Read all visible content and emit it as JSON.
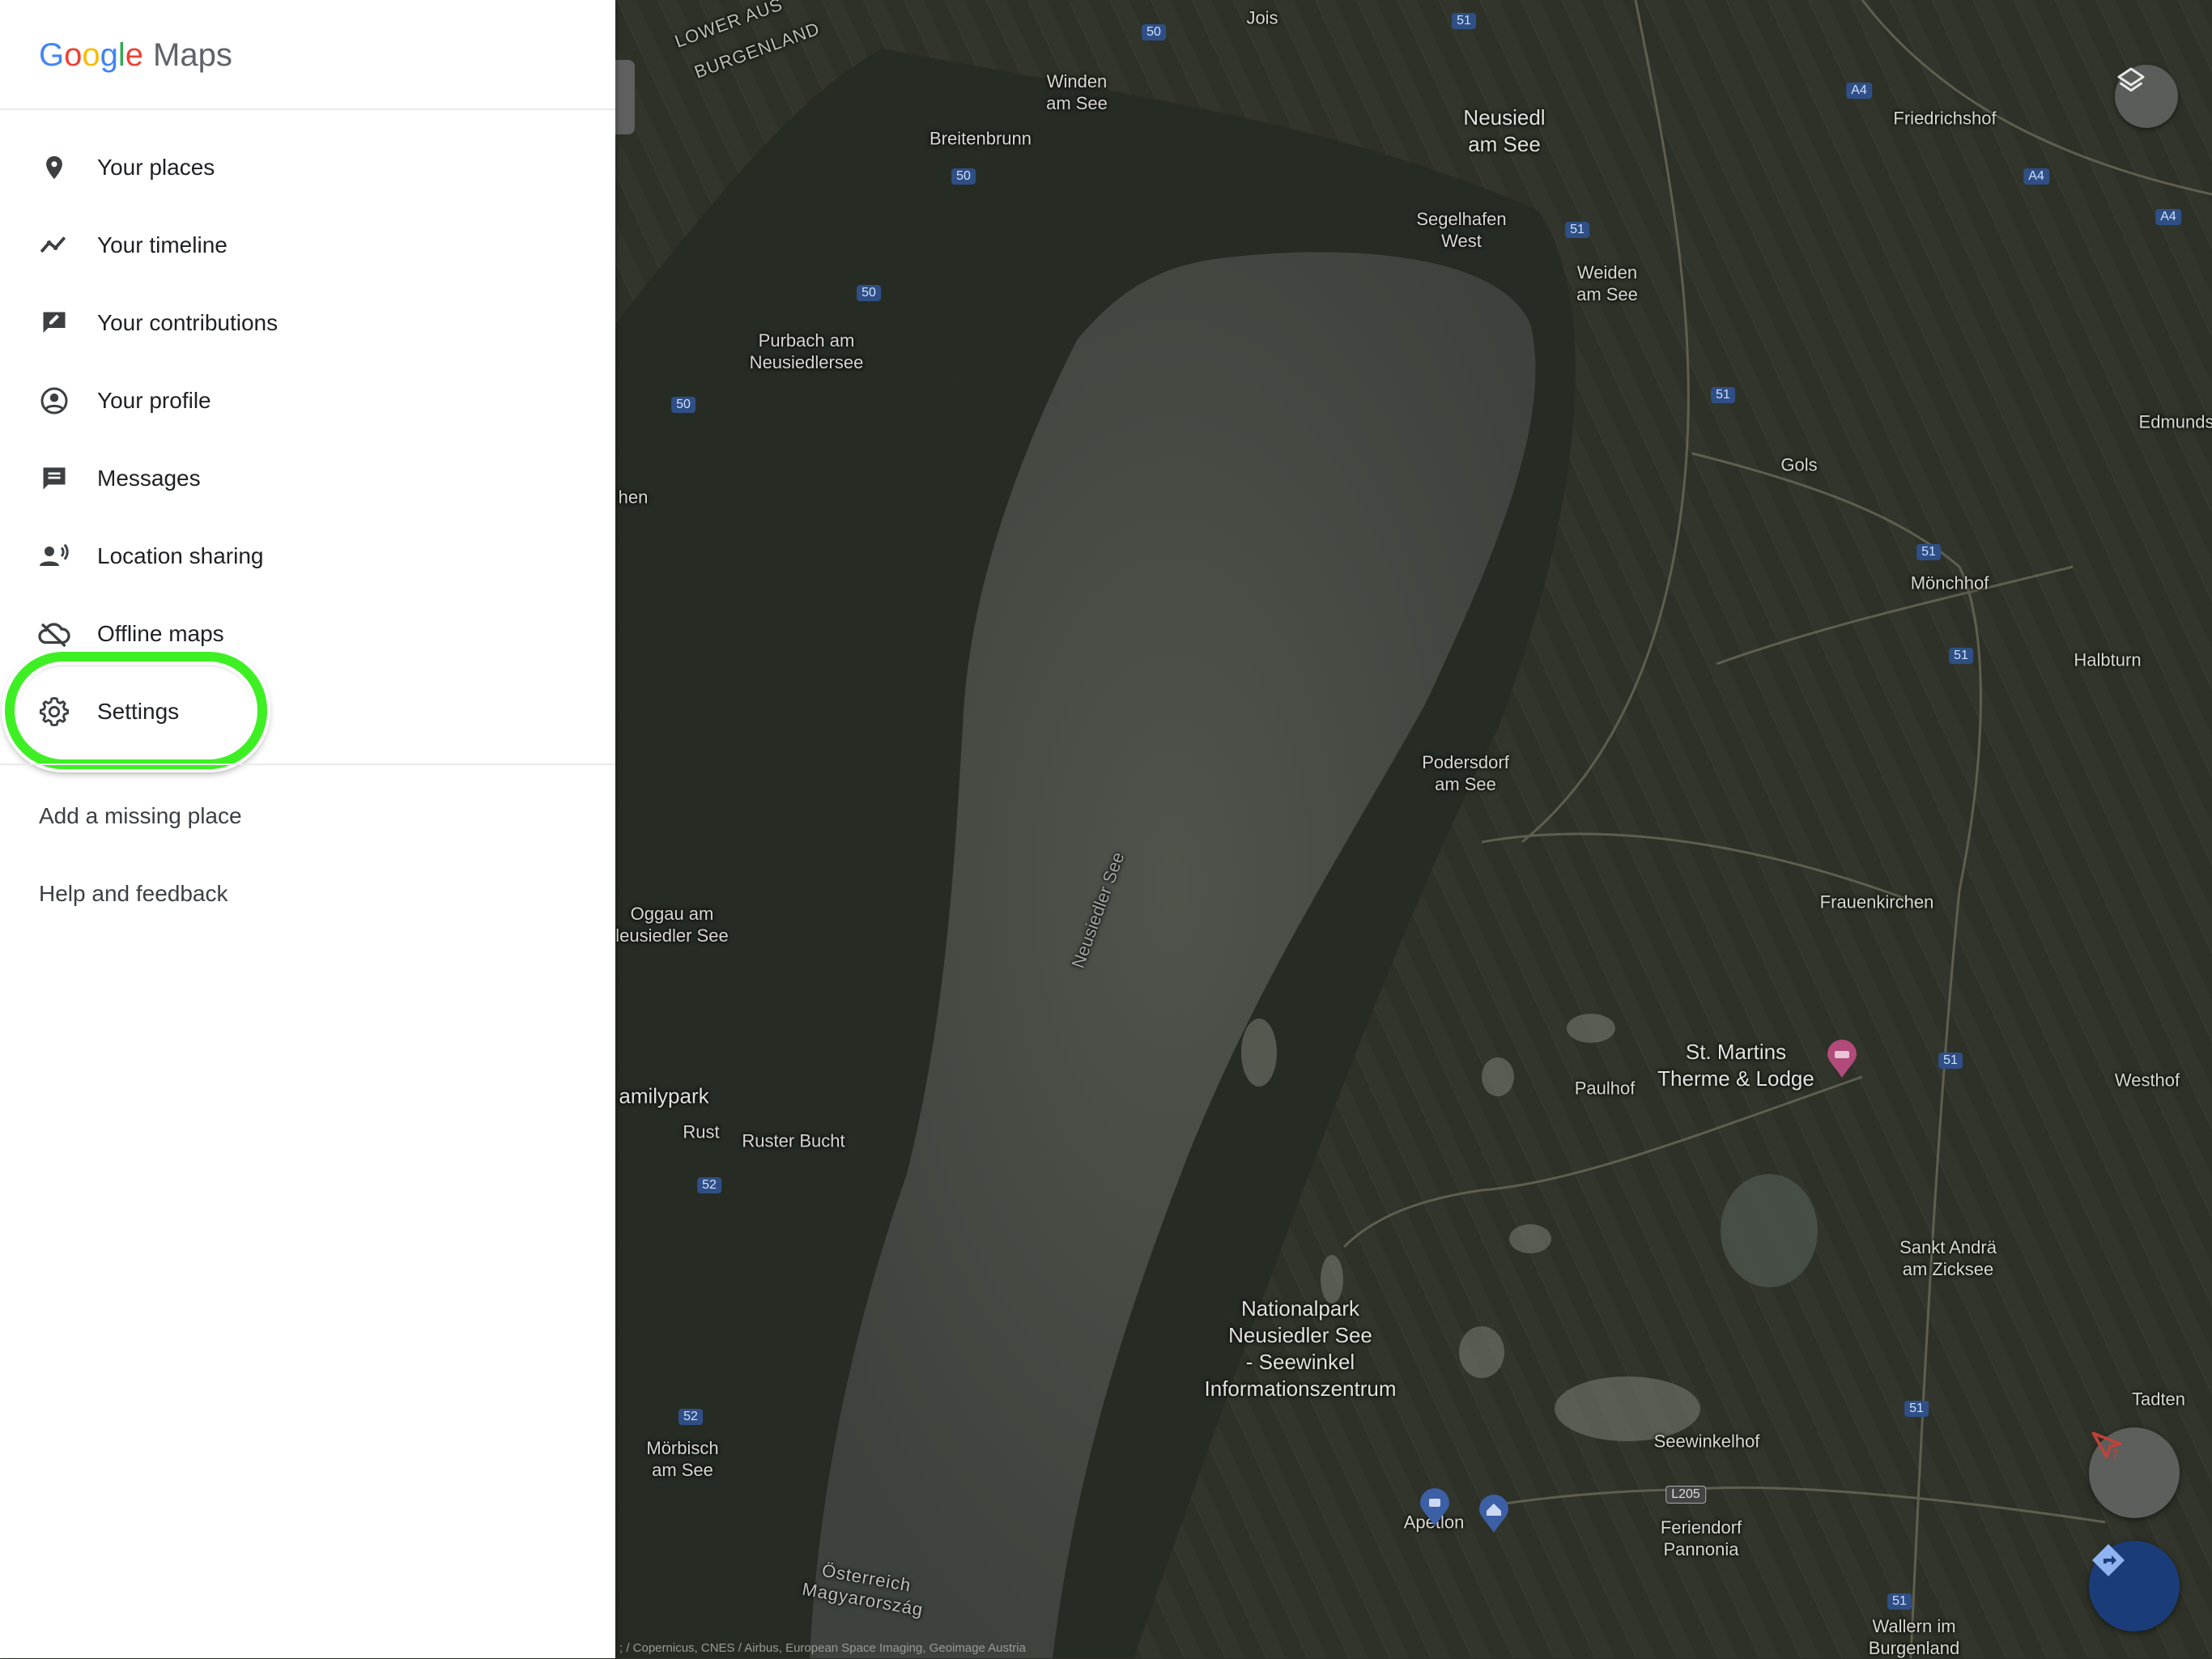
{
  "app": {
    "logo_google": [
      "G",
      "o",
      "o",
      "g",
      "l",
      "e"
    ],
    "logo_google_colors": [
      "#4285F4",
      "#EA4335",
      "#FBBC05",
      "#4285F4",
      "#34A853",
      "#EA4335"
    ],
    "logo_maps": "Maps"
  },
  "drawer": {
    "menu": [
      {
        "label": "Your places",
        "icon": "location-pin-icon"
      },
      {
        "label": "Your timeline",
        "icon": "timeline-icon"
      },
      {
        "label": "Your contributions",
        "icon": "contributions-icon"
      },
      {
        "label": "Your profile",
        "icon": "profile-icon"
      },
      {
        "label": "Messages",
        "icon": "messages-icon"
      },
      {
        "label": "Location sharing",
        "icon": "location-sharing-icon"
      },
      {
        "label": "Offline maps",
        "icon": "offline-cloud-icon"
      },
      {
        "label": "Settings",
        "icon": "gear-icon"
      }
    ],
    "links": {
      "add_missing_place": "Add a missing place",
      "help_feedback": "Help and feedback"
    },
    "highlight_color": "#3ef023"
  },
  "map": {
    "labels": {
      "lower_austria": "LOWER AUS",
      "burgenland": "BURGENLAND",
      "jois": "Jois",
      "winden": "Winden\nam See",
      "neusiedl": "Neusiedl\nam See",
      "friedrichshof": "Friedrichshof",
      "breitenbrunn": "Breitenbrunn",
      "segelhafen": "Segelhafen\nWest",
      "weiden": "Weiden\nam See",
      "purbach": "Purbach am\nNeusiedlersee",
      "gols": "Gols",
      "edmunds": "Edmunds",
      "hen": "hen",
      "monchhof": "Mönchhof",
      "halbturn": "Halbturn",
      "podersdorf": "Podersdorf\nam See",
      "frauenkirchen": "Frauenkirchen",
      "oggau": "Oggau am\nleusiedler See",
      "neusiedler_see": "Neusiedler See",
      "st_martins": "St. Martins\nTherme & Lodge",
      "paulhof": "Paulhof",
      "westhof": "Westhof",
      "familypark": "amilypark",
      "rust": "Rust",
      "ruster_bucht": "Ruster Bucht",
      "sankt_andra": "Sankt Andrä\nam Zicksee",
      "nationalpark": "Nationalpark\nNeusiedler See\n- Seewinkel\nInformationszentrum",
      "tadten": "Tadten",
      "seewinkelhof": "Seewinkelhof",
      "morbisch": "Mörbisch\nam See",
      "apetlon": "Apetlon",
      "feriendorf": "Feriendorf\nPannonia",
      "osterreich": "Österreich\nMagyarország",
      "wallern": "Wallern im\nBurgenland"
    },
    "shields": {
      "s50a": "50",
      "s51a": "51",
      "sa4a": "A4",
      "sa4b": "A4",
      "sa4c": "A4",
      "s50b": "50",
      "s51b": "51",
      "s50c": "50",
      "s50d": "50",
      "s51c": "51",
      "s51d": "51",
      "s51e": "51",
      "s51f": "51",
      "s52a": "52",
      "s52b": "52",
      "s51g": "51",
      "sl205": "L205",
      "s51h": "51"
    },
    "attribution": "; / Copernicus, CNES / Airbus, European Space Imaging, Geoimage Austria",
    "controls": {
      "layers_icon": "layers-icon",
      "feedback_icon": "send-feedback-icon",
      "directions_icon": "directions-icon"
    }
  }
}
